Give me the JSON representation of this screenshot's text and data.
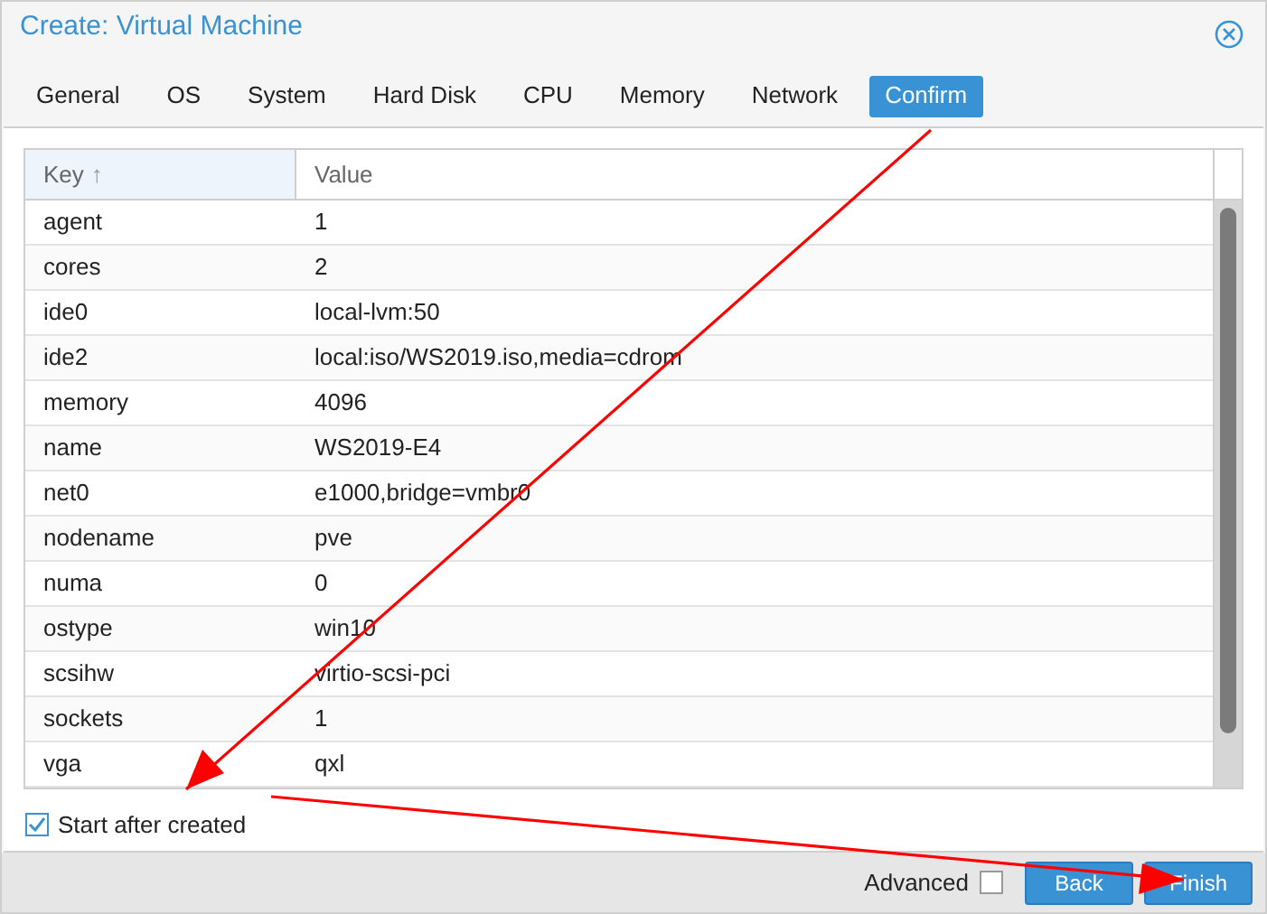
{
  "window": {
    "title": "Create: Virtual Machine"
  },
  "tabs": [
    {
      "label": "General",
      "selected": false
    },
    {
      "label": "OS",
      "selected": false
    },
    {
      "label": "System",
      "selected": false
    },
    {
      "label": "Hard Disk",
      "selected": false
    },
    {
      "label": "CPU",
      "selected": false
    },
    {
      "label": "Memory",
      "selected": false
    },
    {
      "label": "Network",
      "selected": false
    },
    {
      "label": "Confirm",
      "selected": true
    }
  ],
  "table": {
    "columns": [
      {
        "label": "Key",
        "sort_icon": "↑"
      },
      {
        "label": "Value"
      }
    ],
    "rows": [
      [
        "agent",
        "1"
      ],
      [
        "cores",
        "2"
      ],
      [
        "ide0",
        "local-lvm:50"
      ],
      [
        "ide2",
        "local:iso/WS2019.iso,media=cdrom"
      ],
      [
        "memory",
        "4096"
      ],
      [
        "name",
        "WS2019-E4"
      ],
      [
        "net0",
        "e1000,bridge=vmbr0"
      ],
      [
        "nodename",
        "pve"
      ],
      [
        "numa",
        "0"
      ],
      [
        "ostype",
        "win10"
      ],
      [
        "scsihw",
        "virtio-scsi-pci"
      ],
      [
        "sockets",
        "1"
      ],
      [
        "vga",
        "qxl"
      ]
    ]
  },
  "start_after_created": {
    "label": "Start after created",
    "checked": true
  },
  "footer": {
    "advanced": {
      "label": "Advanced",
      "checked": false
    },
    "buttons": [
      "Back",
      "Finish"
    ]
  }
}
